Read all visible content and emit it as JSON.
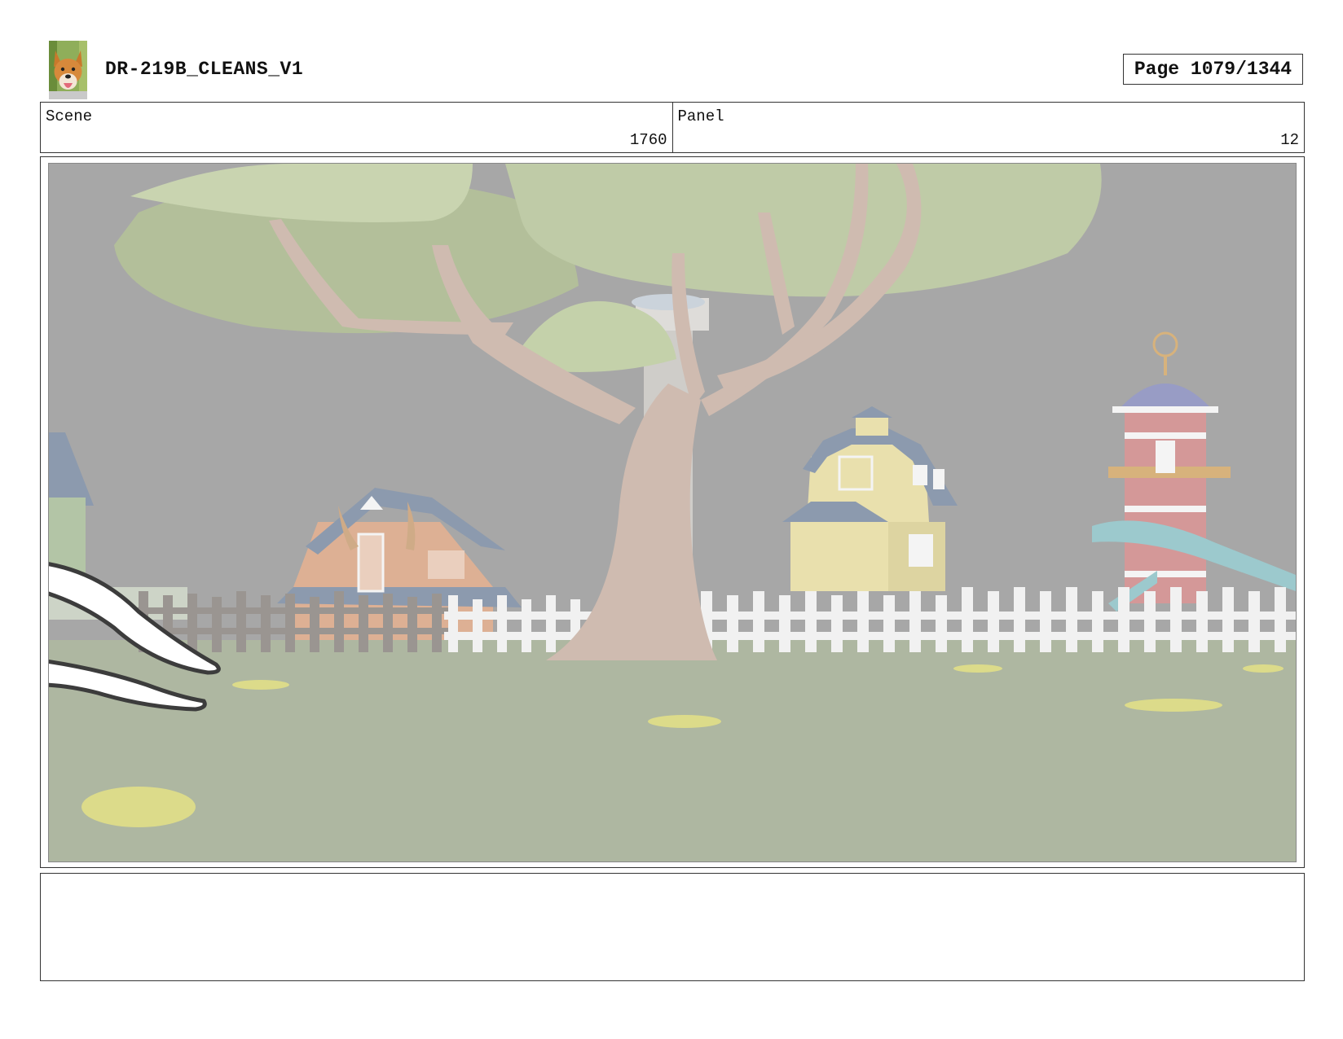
{
  "header": {
    "document_title": "DR-219B_CLEANS_V1",
    "page_label": "Page 1079/1344",
    "logo_icon": "dog-photo-thumbnail-icon"
  },
  "info": {
    "scene_label": "Scene",
    "scene_value": "1760",
    "panel_label": "Panel",
    "panel_value": "12"
  },
  "panel_image": {
    "description_icon": "storyboard-farm-scene-illustration",
    "palette": {
      "sky": "#9b9b9b",
      "grass": "#a3ad94",
      "foliage": "#b7c49b",
      "trunk": "#c9b2a5",
      "fence": "#efefef",
      "barn_orange": "#d9a586",
      "barn_yellow": "#e6dca2",
      "roof_blue": "#7d8da3",
      "tower_red": "#cf8a8a",
      "slide_teal": "#8fc2c6"
    }
  },
  "notes": {
    "text": ""
  }
}
